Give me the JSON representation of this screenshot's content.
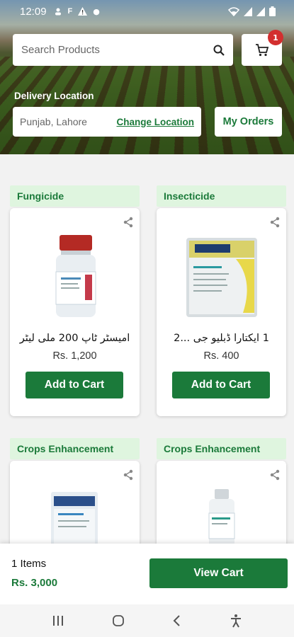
{
  "status_bar": {
    "time": "12:09",
    "icons": [
      "person-icon",
      "f-icon",
      "warning-icon",
      "dot-icon"
    ],
    "right_icons": [
      "wifi-icon",
      "signal-icon",
      "signal-icon",
      "battery-icon"
    ]
  },
  "header": {
    "search_placeholder": "Search Products",
    "cart_badge": "1",
    "delivery_label": "Delivery Location",
    "location": "Punjab, Lahore",
    "change_location": "Change Location",
    "my_orders": "My Orders"
  },
  "products": [
    {
      "category": "Fungicide",
      "name": "امیسٹر ٹاپ 200 ملی لیٹر",
      "price": "Rs. 1,200",
      "button": "Add to Cart"
    },
    {
      "category": "Insecticide",
      "name": "1 ایکتارا ڈبلیو جی ...2",
      "price": "Rs. 400",
      "button": "Add to Cart"
    },
    {
      "category": "Crops Enhancement"
    },
    {
      "category": "Crops Enhancement"
    }
  ],
  "cart_bar": {
    "items": "1 Items",
    "total": "Rs. 3,000",
    "view_cart": "View Cart"
  },
  "colors": {
    "brand_green": "#1b7a3a",
    "category_bg": "#dff5df",
    "badge_red": "#d32f2f"
  }
}
